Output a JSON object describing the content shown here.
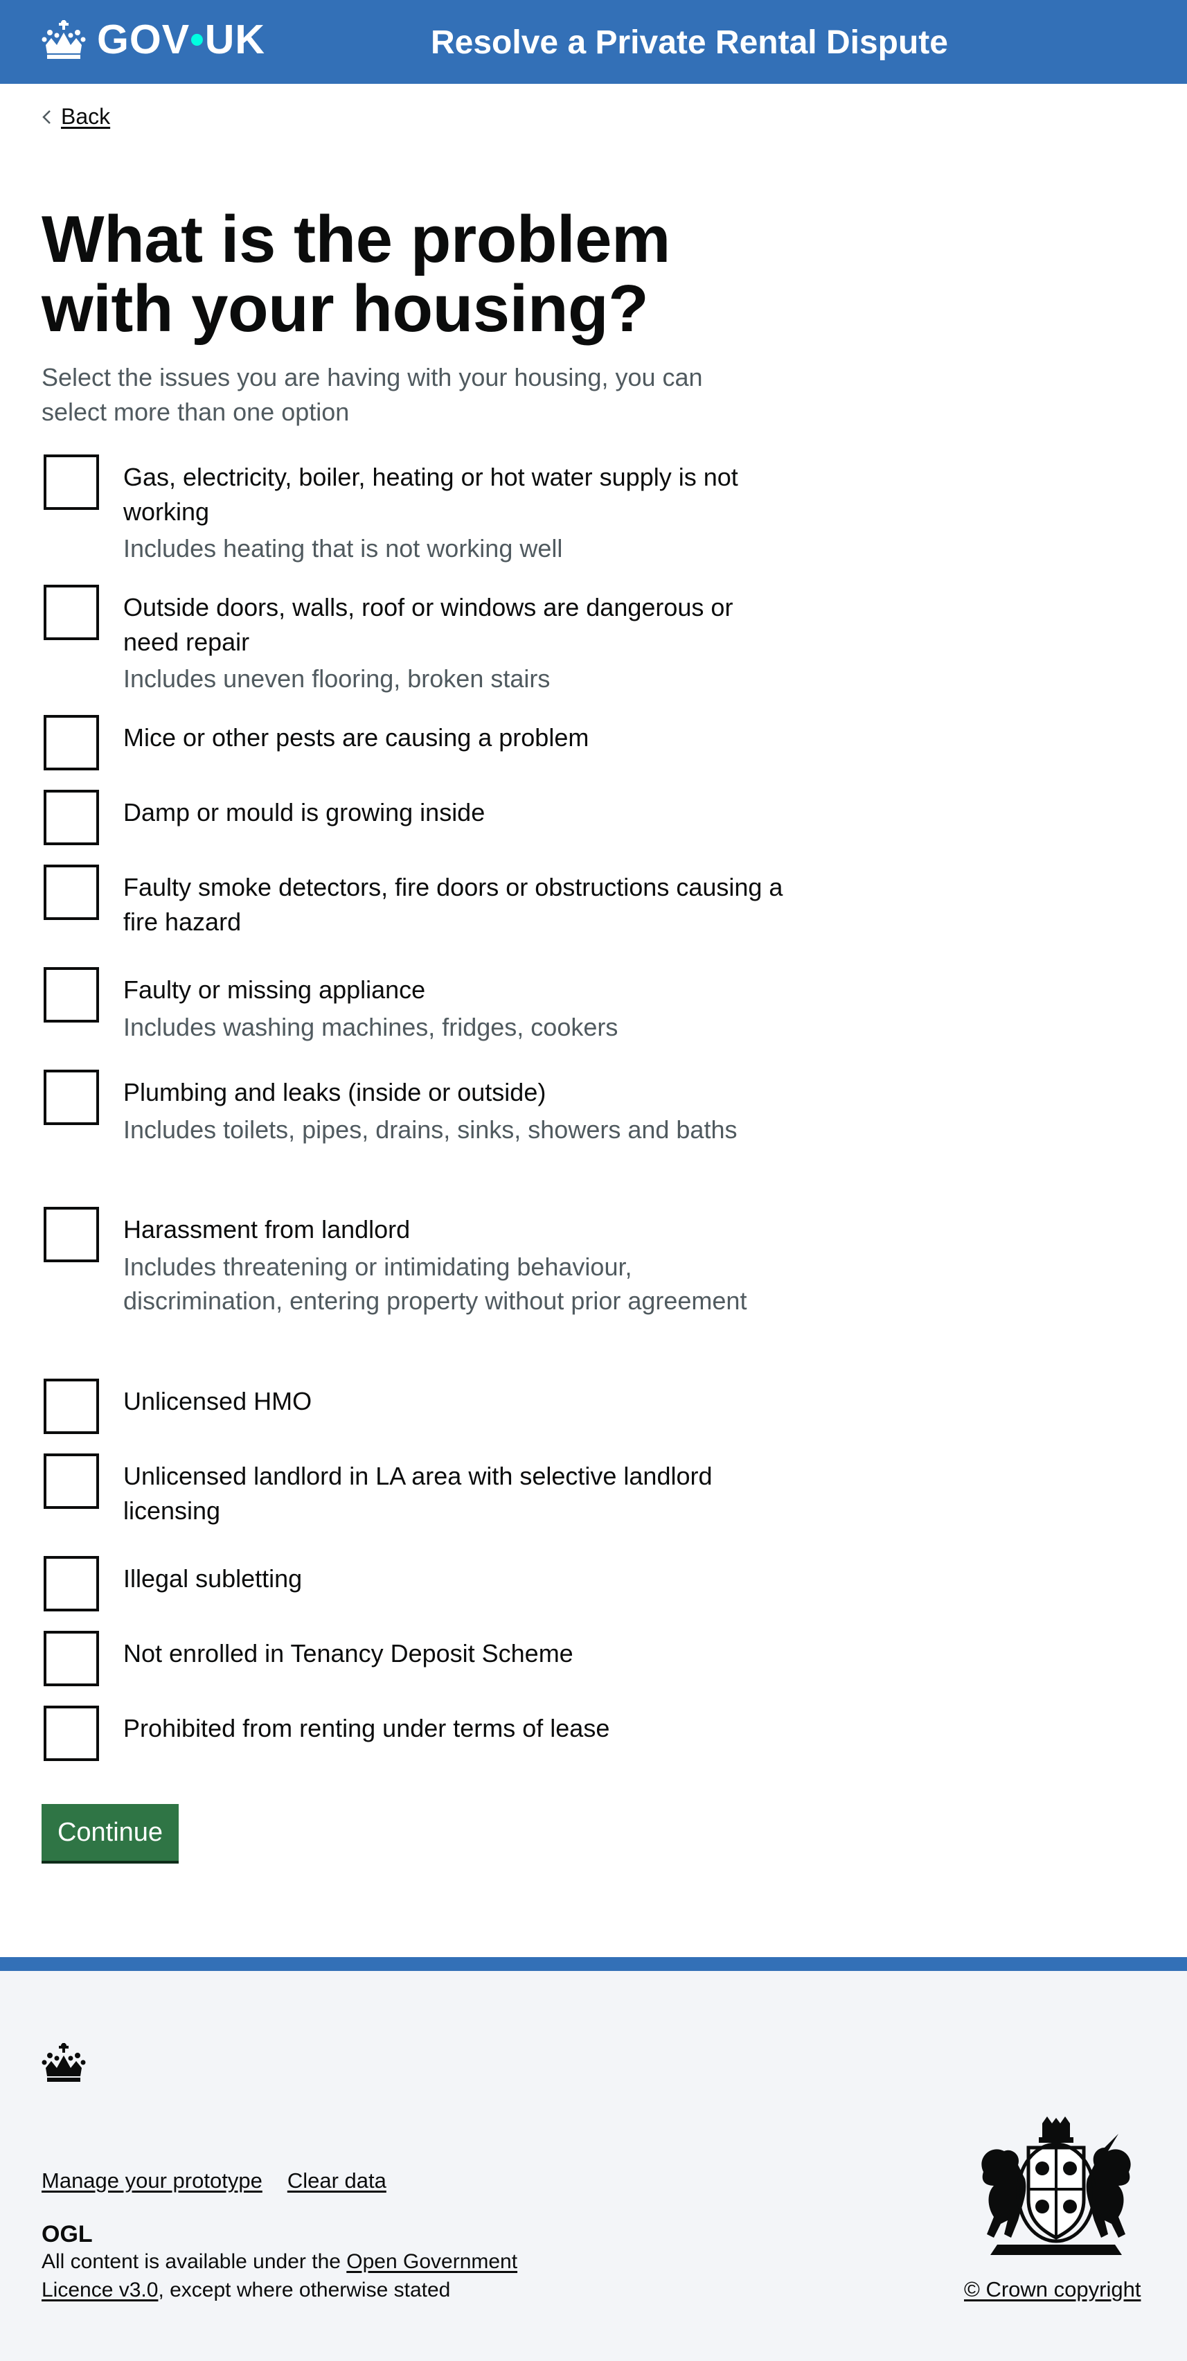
{
  "header": {
    "logo_text_gov": "GOV",
    "logo_dot": "•",
    "logo_text_uk": "UK",
    "service_name": "Resolve a Private Rental Dispute",
    "colors": {
      "background": "#3370b7",
      "logo_dot": "#00ffe0"
    }
  },
  "nav": {
    "back_label": "Back"
  },
  "main": {
    "title": "What is the problem with your housing?",
    "hint": "Select the issues you are having with your housing, you can select more than one option",
    "options": [
      {
        "label": "Gas, electricity, boiler, heating or hot water supply is not working",
        "hint": "Includes heating that is not working well",
        "checked": false
      },
      {
        "label": "Outside doors, walls, roof or windows are dangerous or need repair",
        "hint": "Includes uneven flooring, broken stairs",
        "checked": false
      },
      {
        "label": "Mice or other pests are causing a problem",
        "hint": "",
        "checked": false
      },
      {
        "label": "Damp or mould is growing inside",
        "hint": "",
        "checked": false
      },
      {
        "label": "Faulty smoke detectors, fire doors or obstructions causing a fire hazard",
        "hint": "",
        "checked": false
      },
      {
        "label": "Faulty or missing appliance",
        "hint": "Includes washing machines, fridges, cookers",
        "checked": false
      },
      {
        "label": "Plumbing and leaks (inside or outside)",
        "hint": "Includes toilets, pipes, drains, sinks, showers and baths",
        "checked": false
      },
      {
        "label": "Harassment from landlord",
        "hint": "Includes threatening or intimidating behaviour, discrimination, entering property without prior agreement",
        "checked": false
      },
      {
        "label": "Unlicensed HMO",
        "hint": "",
        "checked": false
      },
      {
        "label": "Unlicensed landlord in LA area with selective landlord licensing",
        "hint": "",
        "checked": false
      },
      {
        "label": "Illegal subletting",
        "hint": "",
        "checked": false
      },
      {
        "label": "Not enrolled in Tenancy Deposit Scheme",
        "hint": "",
        "checked": false
      },
      {
        "label": "Prohibited from renting under terms of lease",
        "hint": "",
        "checked": false
      }
    ],
    "continue_label": "Continue",
    "colors": {
      "button": "#2f7545",
      "hint_text": "#505a5f"
    }
  },
  "footer": {
    "links": [
      "Manage your prototype",
      "Clear data"
    ],
    "ogl_label": "OGL",
    "licence_prefix": "All content is available under the ",
    "licence_link": "Open Government Licence v3.0",
    "licence_suffix": ", except where otherwise stated",
    "copyright": "© Crown copyright",
    "colors": {
      "background": "#f3f5f8",
      "top_border": "#3370b7"
    }
  }
}
